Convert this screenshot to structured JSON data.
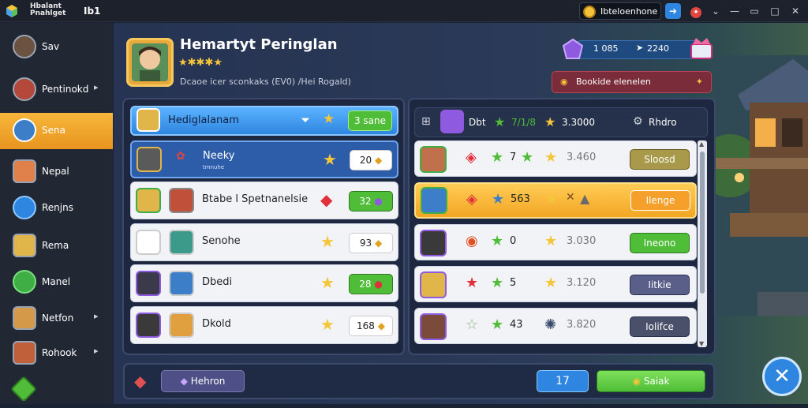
{
  "titlebar": {
    "app_line1": "Hbalant",
    "app_line2": "Pnahlget",
    "app_tag": "Ib1",
    "coins": "Ibteloenhone"
  },
  "sidebar": {
    "items": [
      {
        "label": "Sav",
        "chevron": false
      },
      {
        "label": "Pentinokd",
        "chevron": true
      },
      {
        "label": "Sena",
        "chevron": false,
        "active": true
      },
      {
        "label": "Nepal",
        "chevron": false
      },
      {
        "label": "Renjns",
        "chevron": false
      },
      {
        "label": "Rema",
        "chevron": false
      },
      {
        "label": "Manel",
        "chevron": false
      },
      {
        "label": "Netfon",
        "chevron": true
      },
      {
        "label": "Rohook",
        "chevron": true
      },
      {
        "label": "",
        "chevron": false
      }
    ]
  },
  "profile": {
    "name": "Hemartyt Peringlan",
    "stars": "★✱✱✱★",
    "subtitle": "Dcaoe icer sconkaks (EV0) /Hei Rogald)"
  },
  "currency": {
    "gems": "1 085",
    "gold": "2240"
  },
  "action_button": {
    "label": "Bookide elenelen"
  },
  "left_header": {
    "title": "Hediglalanam",
    "badge": "3 sane"
  },
  "left_rows": [
    {
      "name": "Neeky",
      "sub": "tmnuhe",
      "value": "20",
      "selected": true
    },
    {
      "name": "Btabe l Spetnanelsie",
      "sub": "",
      "value": "32",
      "selected": false
    },
    {
      "name": "Senohe",
      "sub": "",
      "value": "93",
      "selected": false
    },
    {
      "name": "Dbedi",
      "sub": "",
      "value": "28",
      "selected": false
    },
    {
      "name": "Dkold",
      "sub": "",
      "value": "168",
      "selected": false
    }
  ],
  "right_header": {
    "c1": "Dbt",
    "c2": "7/1/8",
    "c3": "3.3000",
    "c4": "Rhdro"
  },
  "right_rows": [
    {
      "mid": "7",
      "score": "3.460",
      "button": "Sloosd",
      "selected": false,
      "btn": "olive"
    },
    {
      "mid": "563",
      "score": "",
      "button": "Ilenge",
      "selected": true,
      "btn": "orange"
    },
    {
      "mid": "0",
      "score": "3.030",
      "button": "Ineono",
      "selected": false,
      "btn": "green"
    },
    {
      "mid": "5",
      "score": "3.120",
      "button": "Iitkie",
      "selected": false,
      "btn": "slate"
    },
    {
      "mid": "43",
      "score": "3.820",
      "button": "Iolifce",
      "selected": false,
      "btn": "slate"
    }
  ],
  "bottom": {
    "left_button": "Hehron",
    "count": "17",
    "confirm_button": "Saiak"
  },
  "colors": {
    "accent": "#f3a624",
    "blue": "#2f86e0",
    "green": "#4fbd37",
    "panel": "#1d2740"
  }
}
